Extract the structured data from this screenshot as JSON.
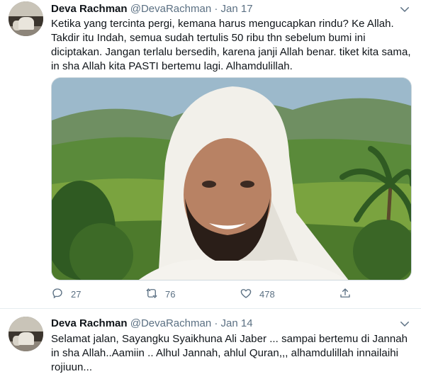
{
  "tweets": [
    {
      "author_name": "Deva Rachman",
      "author_handle": "@DevaRachman",
      "separator": "·",
      "date": "Jan 17",
      "text": "Ketika yang tercinta pergi, kemana harus mengucapkan rindu?  Ke Allah. Takdir itu Indah, semua sudah tertulis 50 ribu thn sebelum bumi ini diciptakan. Jangan terlalu bersedih, karena janji Allah benar. tiket kita sama, in sha Allah kita PASTI bertemu lagi. Alhamdulillah.",
      "media_alt": "photo",
      "actions": {
        "reply_count": "27",
        "retweet_count": "76",
        "like_count": "478"
      }
    },
    {
      "author_name": "Deva Rachman",
      "author_handle": "@DevaRachman",
      "separator": "·",
      "date": "Jan 14",
      "text": "Selamat jalan, Sayangku Syaikhuna Ali Jaber ...  sampai bertemu di Jannah in sha Allah..Aamiin .. Alhul Jannah, ahlul Quran,,,  alhamdulillah innailaihi rojiuun..."
    }
  ],
  "icons": {
    "caret": "chevron-down-icon",
    "reply": "reply-icon",
    "retweet": "retweet-icon",
    "like": "heart-icon",
    "share": "share-icon"
  },
  "colors": {
    "text_primary": "#0f1419",
    "text_secondary": "#5b7083",
    "divider": "#e6ecf0"
  }
}
